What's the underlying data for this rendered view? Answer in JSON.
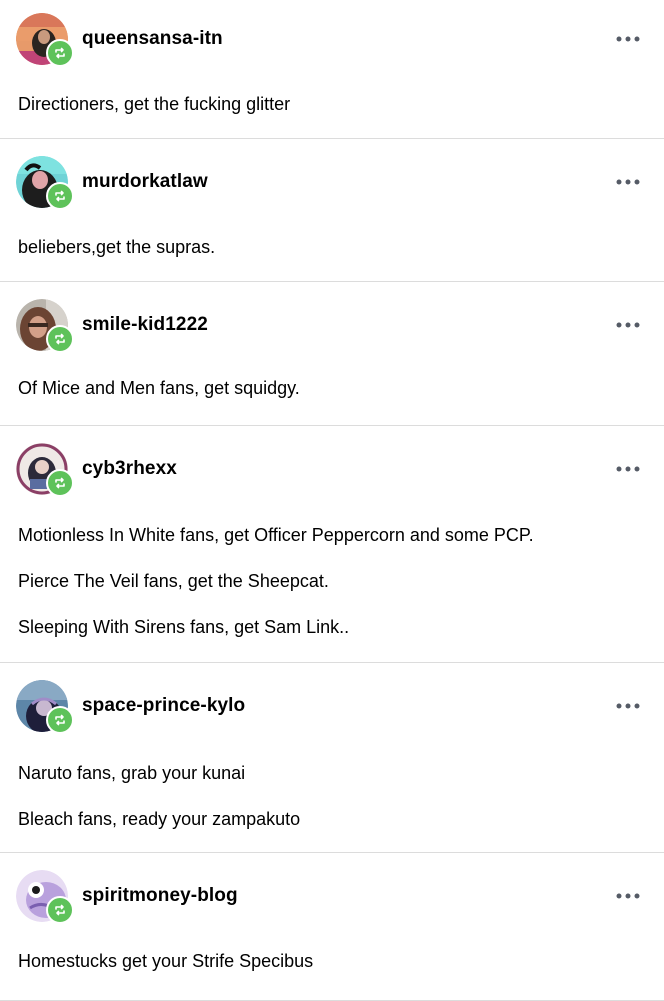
{
  "posts": [
    {
      "username": "queensansa-itn",
      "lines": [
        "Directioners, get the fucking glitter"
      ]
    },
    {
      "username": "murdorkatlaw",
      "lines": [
        "beliebers,get the supras."
      ]
    },
    {
      "username": "smile-kid1222",
      "lines": [
        "Of Mice and Men fans, get squidgy."
      ]
    },
    {
      "username": "cyb3rhexx",
      "lines": [
        "Motionless In White fans, get Officer Peppercorn and some PCP.",
        "Pierce The Veil fans, get the Sheepcat.",
        "Sleeping With Sirens fans, get Sam Link.."
      ]
    },
    {
      "username": "space-prince-kylo",
      "lines": [
        "Naruto fans, grab your kunai",
        "Bleach fans, ready your zampakuto"
      ]
    },
    {
      "username": "spiritmoney-blog",
      "lines": [
        "Homestucks get your Strife Specibus"
      ]
    }
  ],
  "colors": {
    "reblog_badge": "#5ec25a",
    "more_dots": "#555b66",
    "divider": "#dcdcdc"
  },
  "icons": {
    "reblog": "reblog-icon",
    "more": "more-options-icon"
  }
}
